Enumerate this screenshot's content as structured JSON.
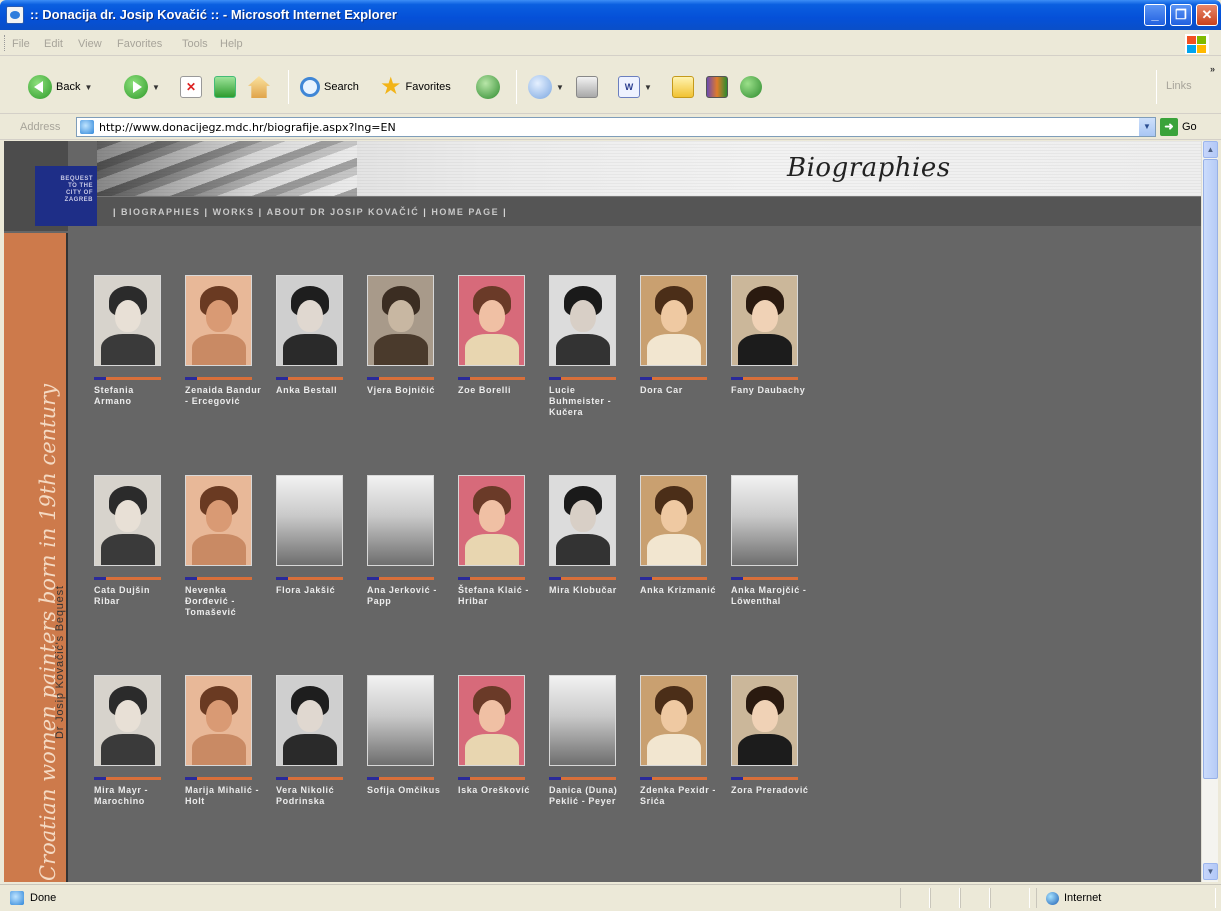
{
  "window": {
    "title": ":: Donacija dr. Josip Kovačić :: - Microsoft Internet Explorer",
    "min_glyph": "_",
    "max_glyph": "❐",
    "close_glyph": "✕"
  },
  "menu": [
    "File",
    "Edit",
    "View",
    "Favorites",
    "Tools",
    "Help"
  ],
  "toolbar": {
    "back_label": "Back",
    "search_label": "Search",
    "favorites_label": "Favorites",
    "links_label": "Links"
  },
  "address": {
    "label": "Address",
    "url": "http://www.donacijegz.mdc.hr/biografije.aspx?lng=EN",
    "go_label": "Go"
  },
  "page": {
    "logo_text": "BEQUEST\nTO THE\nCITY OF\nZAGREB",
    "heading": "Biographies",
    "side_title": "Croatian women painters born in 19th century",
    "side_subtitle": "Dr Josip Kovačić's Bequest",
    "nav": [
      "BIOGRAPHIES",
      "WORKS",
      "ABOUT DR JOSIP KOVAČIĆ",
      "HOME PAGE"
    ],
    "painters": [
      {
        "name": "Stefania Armano",
        "photo": true
      },
      {
        "name": "Zenaida Bandur - Ercegović",
        "photo": true
      },
      {
        "name": "Anka Bestall",
        "photo": true
      },
      {
        "name": "Vjera Bojničić",
        "photo": true
      },
      {
        "name": "Zoe Borelli",
        "photo": true
      },
      {
        "name": "Lucie Buhmeister - Kučera",
        "photo": true
      },
      {
        "name": "Dora Car",
        "photo": true
      },
      {
        "name": "Fany Daubachy",
        "photo": true
      },
      {
        "name": "Cata Dujšin Ribar",
        "photo": true
      },
      {
        "name": "Nevenka Đorđević - Tomašević",
        "photo": true
      },
      {
        "name": "Flora Jakšić",
        "photo": false
      },
      {
        "name": "Ana Jerković - Papp",
        "photo": false
      },
      {
        "name": "Štefana Klaić - Hribar",
        "photo": true
      },
      {
        "name": "Mira Klobučar",
        "photo": true
      },
      {
        "name": "Anka Krizmanić",
        "photo": true
      },
      {
        "name": "Anka Marojčić - Löwenthal",
        "photo": false
      },
      {
        "name": "Mira Mayr - Marochino",
        "photo": true
      },
      {
        "name": "Marija Mihalić - Holt",
        "photo": true
      },
      {
        "name": "Vera Nikolić Podrinska",
        "photo": true
      },
      {
        "name": "Sofija Omčikus",
        "photo": false
      },
      {
        "name": "Iska Oreškovíć",
        "photo": true
      },
      {
        "name": "Danica (Duna) Peklić - Peyer",
        "photo": false
      },
      {
        "name": "Zdenka Pexidr - Srića",
        "photo": true
      },
      {
        "name": "Zora Preradović",
        "photo": true
      }
    ]
  },
  "status": {
    "text": "Done",
    "zone": "Internet"
  }
}
